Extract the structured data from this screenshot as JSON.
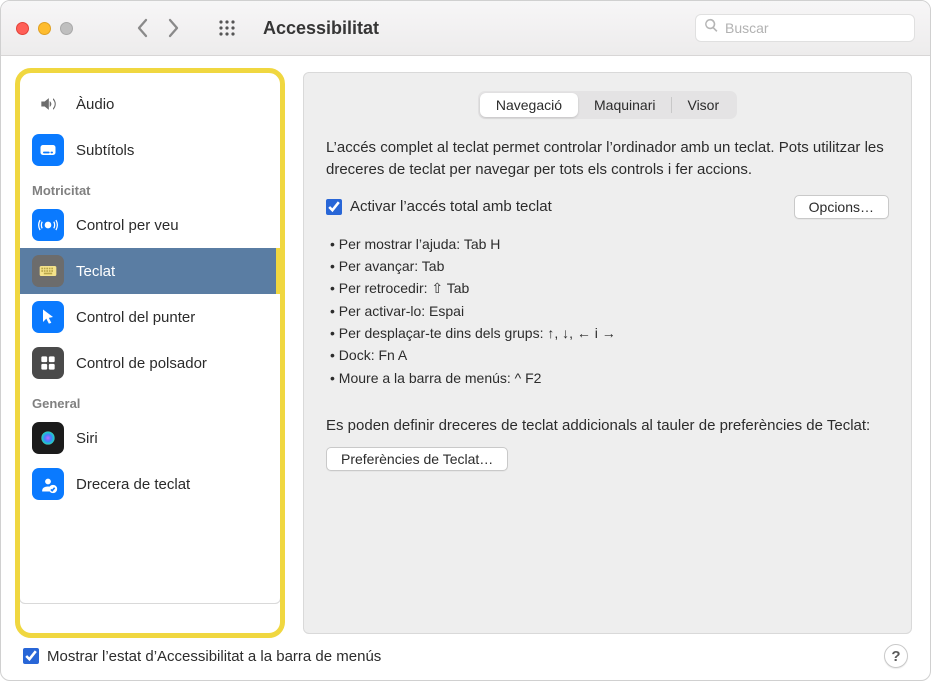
{
  "window": {
    "title": "Accessibilitat",
    "search_placeholder": "Buscar"
  },
  "sidebar": {
    "items": [
      {
        "id": "audio",
        "label": "Àudio",
        "icon": "speaker",
        "color": "#d8d8d8",
        "fg": "#6c6c6c"
      },
      {
        "id": "subtitles",
        "label": "Subtítols",
        "icon": "cc",
        "color": "#0a7aff"
      },
      {
        "section": "Motricitat"
      },
      {
        "id": "voice-control",
        "label": "Control per veu",
        "icon": "voice",
        "color": "#0a7aff"
      },
      {
        "id": "keyboard",
        "label": "Teclat",
        "icon": "keyboard",
        "color": "#6c6c6c",
        "selected": true
      },
      {
        "id": "pointer",
        "label": "Control del punter",
        "icon": "pointer",
        "color": "#0a7aff"
      },
      {
        "id": "switch",
        "label": "Control de polsador",
        "icon": "switch",
        "color": "#4a4a4a"
      },
      {
        "section": "General"
      },
      {
        "id": "siri",
        "label": "Siri",
        "icon": "siri",
        "color": "radial"
      },
      {
        "id": "shortcut",
        "label": "Drecera de teclat",
        "icon": "shortcut",
        "color": "#0a7aff"
      }
    ]
  },
  "content": {
    "tabs": [
      {
        "id": "nav",
        "label": "Navegació",
        "active": true
      },
      {
        "id": "hw",
        "label": "Maquinari"
      },
      {
        "id": "visor",
        "label": "Visor"
      }
    ],
    "description": "L’accés complet al teclat permet controlar l’ordinador amb un teclat. Pots utilitzar les dreceres de teclat per navegar per tots els controls i fer accions.",
    "full_access": {
      "label": "Activar l’accés total amb teclat",
      "checked": true,
      "options_label": "Opcions…"
    },
    "hints": [
      "Per mostrar l’ajuda: Tab H",
      "Per avançar: Tab",
      "Per retrocedir: ⇧ Tab",
      "Per activar-lo: Espai",
      "Per desplaçar-te dins dels grups: ↑, ↓, ← i →",
      "Dock: Fn A",
      "Moure a la barra de menús: ^ F2"
    ],
    "sub_description": "Es poden definir dreceres de teclat addicionals al tauler de preferències de Teclat:",
    "kb_prefs_label": "Preferències de Teclat…"
  },
  "footer": {
    "menubar_label": "Mostrar l’estat d’Accessibilitat a la barra de menús",
    "menubar_checked": true,
    "help": "?"
  }
}
